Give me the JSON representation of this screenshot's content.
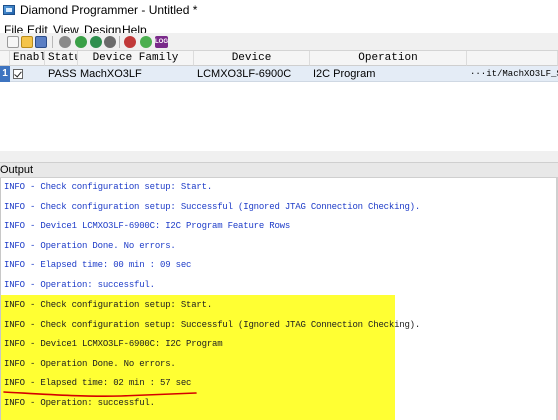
{
  "window": {
    "title": "Diamond Programmer - Untitled *",
    "icon": "diamond-programmer-app-icon"
  },
  "menu": [
    "File",
    "Edit",
    "View",
    "Design",
    "Help"
  ],
  "toolbar": {
    "icons": [
      "new-file-icon",
      "open-folder-icon",
      "save-icon",
      "scan-chain-icon",
      "program-icon",
      "program-all-icon",
      "settings-gear-icon",
      "device-properties-icon",
      "go-arrow-icon",
      "log-icon"
    ],
    "log_label": "LOG"
  },
  "grid": {
    "columns": [
      "Enable",
      "Status",
      "Device Family",
      "Device",
      "Operation",
      ""
    ],
    "rows": [
      {
        "index": "1",
        "enable": true,
        "status": "PASS",
        "family": "MachXO3LF",
        "device": "LCMXO3LF-6900C",
        "operation": "I2C Program",
        "file": "···it/MachXO3LF_Star"
      }
    ]
  },
  "output": {
    "title": "Output",
    "lines": [
      "INFO - Check configuration setup: Start.",
      "INFO - Check configuration setup: Successful (Ignored JTAG Connection Checking).",
      "INFO - Device1 LCMXO3LF-6900C: I2C Program Feature Rows",
      "INFO - Operation Done. No errors.",
      "INFO - Elapsed time: 00 min : 09 sec",
      "INFO - Operation: successful.",
      "INFO - Check configuration setup: Start.",
      "INFO - Check configuration setup: Successful (Ignored JTAG Connection Checking).",
      "INFO - Device1 LCMXO3LF-6900C: I2C Program",
      "INFO - Operation Done. No errors.",
      "INFO - Elapsed time: 02 min : 57 sec",
      "INFO - Operation: successful."
    ]
  },
  "colors": {
    "highlight": "#ffff33",
    "annotation": "#d40000",
    "info_text": "#1e3cc8",
    "selected_row": "#e4ecf6"
  }
}
